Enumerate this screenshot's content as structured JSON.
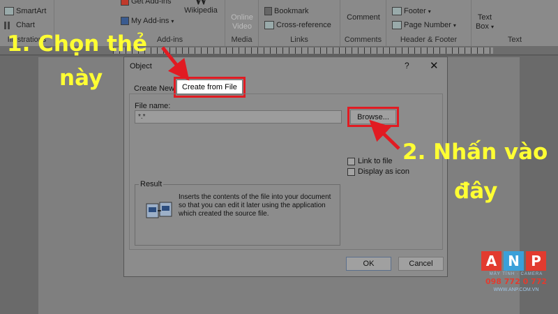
{
  "ribbon": {
    "illustrations": {
      "smartart": "SmartArt",
      "chart": "Chart",
      "label": "Illustrations"
    },
    "addins": {
      "get_addins": "Get Add-ins",
      "my_addins": "My Add-ins",
      "wikipedia": "Wikipedia",
      "label": "Add-ins"
    },
    "media": {
      "online_video": "Online Video",
      "online_video_line1": "Online",
      "online_video_line2": "Video",
      "label": "Media"
    },
    "links": {
      "bookmark": "Bookmark",
      "cross_reference": "Cross-reference",
      "label": "Links"
    },
    "comments": {
      "comment": "Comment",
      "label": "Comments"
    },
    "header_footer": {
      "footer": "Footer",
      "page_number": "Page Number",
      "label": "Header & Footer"
    },
    "text": {
      "text_box_line1": "Text",
      "text_box_line2": "Box",
      "label": "Text"
    }
  },
  "dialog": {
    "title": "Object",
    "help": "?",
    "close": "✕",
    "tabs": [
      "Create New",
      "Create from File"
    ],
    "active_tab": "Create from File",
    "file_name_label": "File name:",
    "file_name_value": "*.*",
    "browse_label": "Browse...",
    "link_to_file_label": "Link to file",
    "display_as_icon_label": "Display as icon",
    "link_to_file_checked": false,
    "display_as_icon_checked": false,
    "result_label": "Result",
    "result_text": "Inserts the contents of the file into your document so that you can edit it later using the application which created the source file.",
    "ok_label": "OK",
    "cancel_label": "Cancel"
  },
  "annotations": {
    "step1_line1": "1. Chọn thẻ",
    "step1_line2": "này",
    "step2_line1": "2. Nhấn vào",
    "step2_line2": "đây",
    "arrow_color": "#e11b22",
    "text_color": "#ffff33"
  },
  "logo": {
    "letters": [
      "A",
      "N",
      "P"
    ],
    "tagline": "MÁY TÍNH · CAMERA",
    "phone": "098 772 0 772",
    "website": "WWW.ANP.COM.VN"
  }
}
